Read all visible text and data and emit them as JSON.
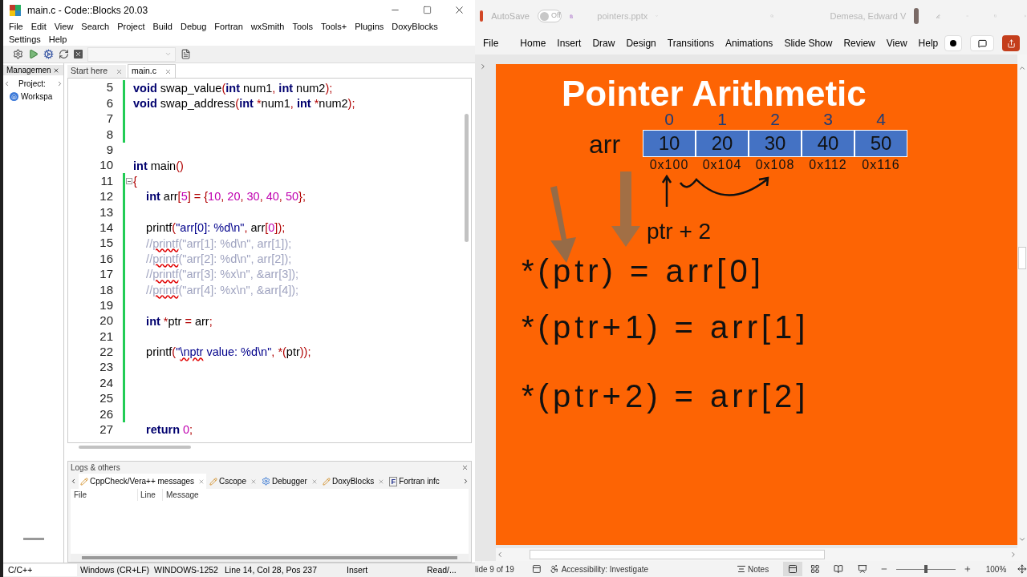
{
  "codeblocks": {
    "title": "main.c - Code::Blocks 20.03",
    "menu": [
      "File",
      "Edit",
      "View",
      "Search",
      "Project",
      "Build",
      "Debug",
      "Fortran",
      "wxSmith",
      "Tools",
      "Tools+",
      "Plugins",
      "DoxyBlocks",
      "Settings",
      "Help"
    ],
    "management": {
      "tab": "Managemen",
      "project_tab": "Project:",
      "workspace": "Workspa"
    },
    "editor_tabs": [
      {
        "label": "Start here",
        "selected": false
      },
      {
        "label": "main.c",
        "selected": true
      }
    ],
    "lines": [
      {
        "n": "5",
        "changed": true,
        "fold": false,
        "tokens": [
          {
            "kind": "kw",
            "text": "void"
          },
          {
            "kind": "id",
            "text": " swap_value"
          },
          {
            "kind": "op",
            "text": "("
          },
          {
            "kind": "kw",
            "text": "int"
          },
          {
            "kind": "id",
            "text": " num1"
          },
          {
            "kind": "op",
            "text": ", "
          },
          {
            "kind": "kw",
            "text": "int"
          },
          {
            "kind": "id",
            "text": " num2"
          },
          {
            "kind": "op",
            "text": ");"
          }
        ]
      },
      {
        "n": "6",
        "changed": true,
        "fold": false,
        "tokens": [
          {
            "kind": "kw",
            "text": "void"
          },
          {
            "kind": "id",
            "text": " swap_address"
          },
          {
            "kind": "op",
            "text": "("
          },
          {
            "kind": "kw",
            "text": "int"
          },
          {
            "kind": "op",
            "text": " *"
          },
          {
            "kind": "id",
            "text": "num1"
          },
          {
            "kind": "op",
            "text": ", "
          },
          {
            "kind": "kw",
            "text": "int"
          },
          {
            "kind": "op",
            "text": " *"
          },
          {
            "kind": "id",
            "text": "num2"
          },
          {
            "kind": "op",
            "text": ");"
          }
        ]
      },
      {
        "n": "7",
        "changed": true,
        "fold": false
      },
      {
        "n": "8",
        "changed": true,
        "fold": false
      },
      {
        "n": "9",
        "changed": false,
        "fold": false
      },
      {
        "n": "10",
        "changed": false,
        "fold": false,
        "tokens": [
          {
            "kind": "kw",
            "text": "int"
          },
          {
            "kind": "id",
            "text": " main"
          },
          {
            "kind": "op",
            "text": "()"
          }
        ]
      },
      {
        "n": "11",
        "changed": true,
        "fold": true,
        "tokens": [
          {
            "kind": "op",
            "text": "{"
          }
        ]
      },
      {
        "n": "12",
        "changed": true,
        "fold": false,
        "tokens": [
          {
            "kind": "kw",
            "text": "    int"
          },
          {
            "kind": "id",
            "text": " arr"
          },
          {
            "kind": "op",
            "text": "["
          },
          {
            "kind": "num",
            "text": "5"
          },
          {
            "kind": "op",
            "text": "] = {"
          },
          {
            "kind": "num",
            "text": "10"
          },
          {
            "kind": "op",
            "text": ", "
          },
          {
            "kind": "num",
            "text": "20"
          },
          {
            "kind": "op",
            "text": ", "
          },
          {
            "kind": "num",
            "text": "30"
          },
          {
            "kind": "op",
            "text": ", "
          },
          {
            "kind": "num",
            "text": "40"
          },
          {
            "kind": "op",
            "text": ", "
          },
          {
            "kind": "num",
            "text": "50"
          },
          {
            "kind": "op",
            "text": "};"
          }
        ]
      },
      {
        "n": "13",
        "changed": true,
        "fold": false
      },
      {
        "n": "14",
        "changed": true,
        "fold": false,
        "tokens": [
          {
            "kind": "id",
            "text": "    printf"
          },
          {
            "kind": "op",
            "text": "("
          },
          {
            "kind": "str",
            "text": "\"arr[0]: %d\\n\""
          },
          {
            "kind": "op",
            "text": ", "
          },
          {
            "kind": "id",
            "text": "arr"
          },
          {
            "kind": "op",
            "text": "["
          },
          {
            "kind": "num",
            "text": "0"
          },
          {
            "kind": "op",
            "text": "]);"
          }
        ]
      },
      {
        "n": "15",
        "changed": true,
        "fold": false,
        "tokens": [
          {
            "kind": "cmt",
            "text": "    //"
          },
          {
            "kind": "cmt_err",
            "text": "printf"
          },
          {
            "kind": "cmt",
            "text": "(\"arr[1]: %d\\n\", arr[1]);"
          }
        ]
      },
      {
        "n": "16",
        "changed": true,
        "fold": false,
        "tokens": [
          {
            "kind": "cmt",
            "text": "    //"
          },
          {
            "kind": "cmt_err",
            "text": "printf"
          },
          {
            "kind": "cmt",
            "text": "(\"arr[2]: %d\\n\", arr[2]);"
          }
        ]
      },
      {
        "n": "17",
        "changed": true,
        "fold": false,
        "tokens": [
          {
            "kind": "cmt",
            "text": "    //"
          },
          {
            "kind": "cmt_err",
            "text": "printf"
          },
          {
            "kind": "cmt",
            "text": "(\"arr[3]: %x\\n\", &arr[3]);"
          }
        ]
      },
      {
        "n": "18",
        "changed": true,
        "fold": false,
        "tokens": [
          {
            "kind": "cmt",
            "text": "    //"
          },
          {
            "kind": "cmt_err",
            "text": "printf"
          },
          {
            "kind": "cmt",
            "text": "(\"arr[4]: %x\\n\", &arr[4]);"
          }
        ]
      },
      {
        "n": "19",
        "changed": true,
        "fold": false
      },
      {
        "n": "20",
        "changed": true,
        "fold": false,
        "tokens": [
          {
            "kind": "kw",
            "text": "    int"
          },
          {
            "kind": "op",
            "text": " *"
          },
          {
            "kind": "id",
            "text": "ptr "
          },
          {
            "kind": "op",
            "text": "="
          },
          {
            "kind": "id",
            "text": " arr"
          },
          {
            "kind": "op",
            "text": ";"
          }
        ]
      },
      {
        "n": "21",
        "changed": true,
        "fold": false
      },
      {
        "n": "22",
        "changed": true,
        "fold": false,
        "tokens": [
          {
            "kind": "id",
            "text": "    printf"
          },
          {
            "kind": "op",
            "text": "("
          },
          {
            "kind": "str",
            "text": "\""
          },
          {
            "kind": "str_err",
            "text": "\\nptr"
          },
          {
            "kind": "str",
            "text": " value: %d\\n\""
          },
          {
            "kind": "op",
            "text": ", *("
          },
          {
            "kind": "id",
            "text": "ptr"
          },
          {
            "kind": "op",
            "text": "));"
          }
        ]
      },
      {
        "n": "23",
        "changed": true,
        "fold": false
      },
      {
        "n": "24",
        "changed": true,
        "fold": false
      },
      {
        "n": "25",
        "changed": true,
        "fold": false
      },
      {
        "n": "26",
        "changed": true,
        "fold": false
      },
      {
        "n": "27",
        "changed": false,
        "fold": false,
        "tokens": [
          {
            "kind": "kw",
            "text": "    return"
          },
          {
            "kind": "num",
            "text": " 0"
          },
          {
            "kind": "op",
            "text": ";"
          }
        ]
      }
    ],
    "logs": {
      "title": "Logs & others",
      "tabs": [
        {
          "label": "CppCheck/Vera++ messages",
          "kind": "plugin",
          "selected": true
        },
        {
          "label": "Cscope",
          "kind": "plugin",
          "selected": false
        },
        {
          "label": "Debugger",
          "kind": "debugger",
          "selected": false
        },
        {
          "label": "DoxyBlocks",
          "kind": "plugin",
          "selected": false
        },
        {
          "label": "Fortran infc",
          "kind": "fortran",
          "glyph": "F",
          "selected": false
        }
      ],
      "columns": [
        "File",
        "Line",
        "Message"
      ]
    },
    "status": [
      "C/C++",
      "Windows (CR+LF)",
      "WINDOWS-1252",
      "Line 14, Col 28, Pos 237",
      "Insert",
      "Read/..."
    ]
  },
  "powerpoint": {
    "autosave": {
      "label": "AutoSave",
      "on": false,
      "state_text": "Off"
    },
    "file_name": "pointers.pptx",
    "user": "Demesa, Edward V",
    "tabs": [
      "File",
      "Home",
      "Insert",
      "Draw",
      "Design",
      "Transitions",
      "Animations",
      "Slide Show",
      "Review",
      "View",
      "Help"
    ],
    "slide": {
      "title": "Pointer Arithmetic",
      "array_label": "arr",
      "cells": [
        {
          "index": "0",
          "value": "10",
          "address": "0x100"
        },
        {
          "index": "1",
          "value": "20",
          "address": "0x104"
        },
        {
          "index": "2",
          "value": "30",
          "address": "0x108"
        },
        {
          "index": "3",
          "value": "40",
          "address": "0x112"
        },
        {
          "index": "4",
          "value": "50",
          "address": "0x116"
        }
      ],
      "annotation": "ptr + 2",
      "equations": [
        "*(ptr) = arr[0]",
        "*(ptr+1) = arr[1]",
        "*(ptr+2) = arr[2]"
      ]
    },
    "status": {
      "slide": "lide 9 of 19",
      "accessibility": "Accessibility: Investigate",
      "notes": "Notes",
      "zoom": {
        "level": 0.5,
        "reading": "100%"
      }
    }
  }
}
